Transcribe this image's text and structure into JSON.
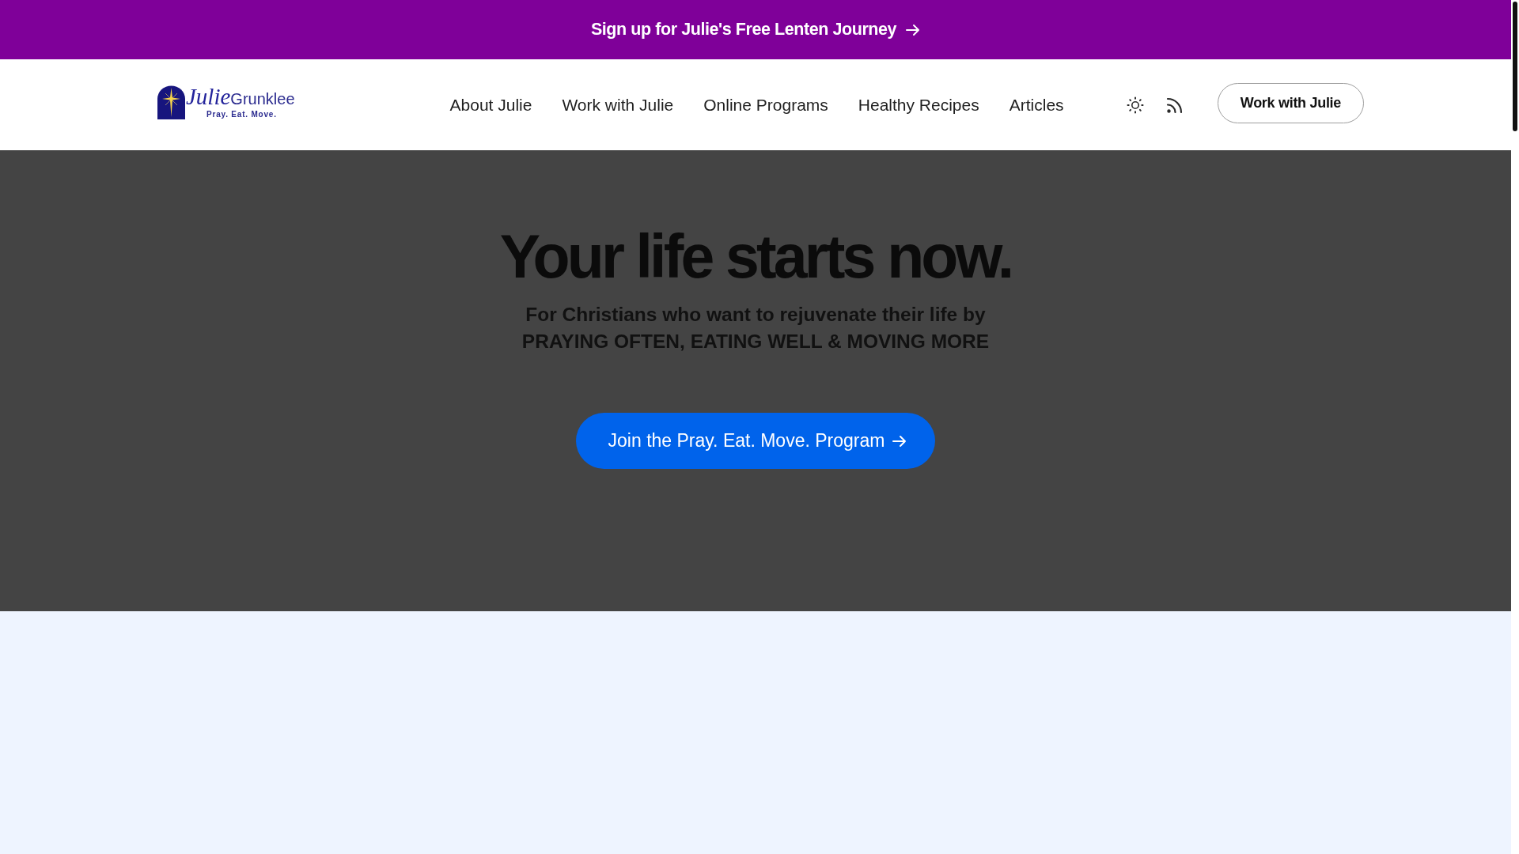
{
  "announcement_bar": {
    "link": "Sign up for Julie's Free Lenten Journey"
  },
  "header": {
    "logo": {
      "script_text": "Julie",
      "text": "Grunklee",
      "tagline": "Pray. Eat. Move."
    },
    "nav": [
      {
        "label": "About Julie"
      },
      {
        "label": "Work with Julie"
      },
      {
        "label": "Online Programs"
      },
      {
        "label": "Healthy Recipes"
      },
      {
        "label": "Articles"
      }
    ],
    "cta_button": "Work with Julie"
  },
  "hero": {
    "title": "Your life starts now.",
    "subtitle_lines": [
      "For Christians who want to rejuvenate their life by",
      "PRAYING OFTEN, EATING WELL & MOVING MORE"
    ],
    "button": "Join the Pray. Eat. Move. Program"
  }
}
